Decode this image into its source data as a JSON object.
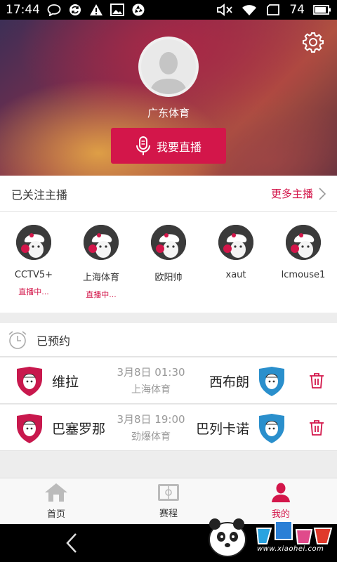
{
  "status_bar": {
    "time": "17:44",
    "battery": "74"
  },
  "profile": {
    "name": "广东体育",
    "live_button": "我要直播"
  },
  "followed": {
    "title": "已关注主播",
    "more_label": "更多主播",
    "anchors": [
      {
        "name": "CCTV5+",
        "status": "直播中..."
      },
      {
        "name": "上海体育",
        "status": "直播中..."
      },
      {
        "name": "欧阳帅",
        "status": ""
      },
      {
        "name": "xaut",
        "status": ""
      },
      {
        "name": "lcmouse1",
        "status": ""
      }
    ]
  },
  "reserved": {
    "title": "已预约",
    "matches": [
      {
        "home": "维拉",
        "time": "3月8日  01:30",
        "channel": "上海体育",
        "away": "西布朗"
      },
      {
        "home": "巴塞罗那",
        "time": "3月8日  19:00",
        "channel": "劲爆体育",
        "away": "巴列卡诺"
      }
    ]
  },
  "tabs": [
    {
      "label": "首页",
      "icon": "home-icon"
    },
    {
      "label": "赛程",
      "icon": "schedule-icon"
    },
    {
      "label": "我的",
      "icon": "user-icon",
      "active": true
    }
  ],
  "watermark": {
    "text": "www.xiaohei.com"
  },
  "colors": {
    "accent": "#d3164a",
    "home_crest": "#c8184d",
    "away_crest": "#2a8fcc"
  }
}
